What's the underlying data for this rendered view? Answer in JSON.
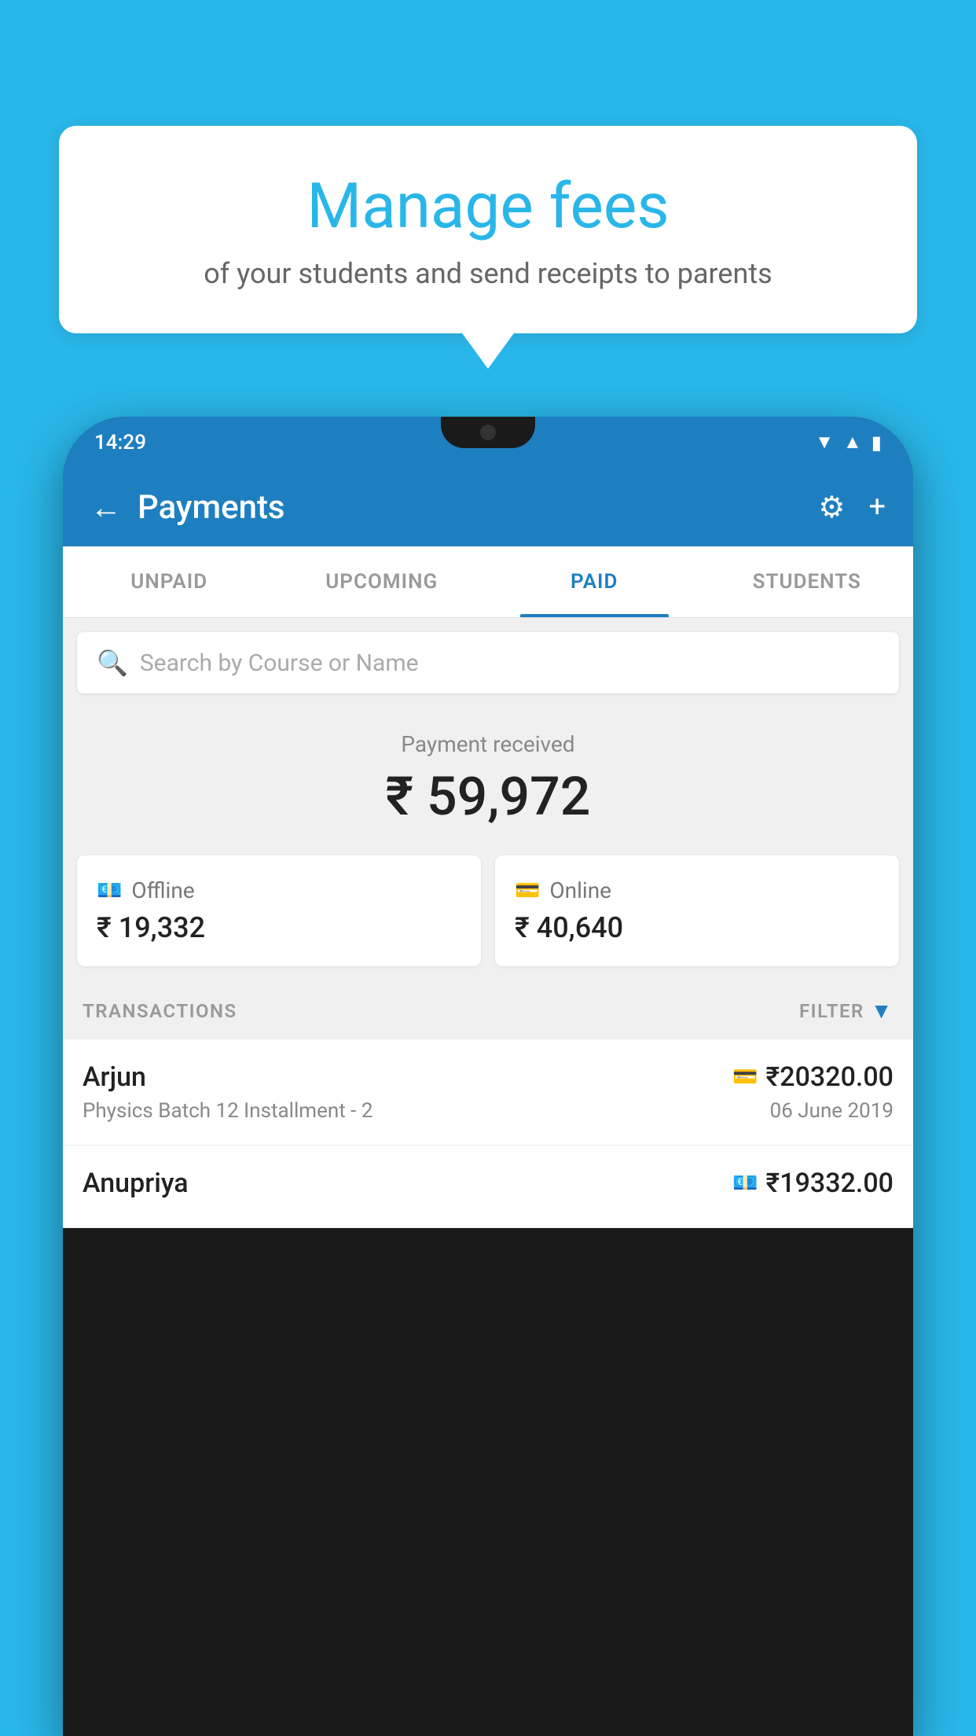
{
  "background_color": "#29b6e8",
  "speech_bubble": {
    "title": "Manage fees",
    "subtitle": "of your students and send receipts to parents"
  },
  "status_bar": {
    "time": "14:29",
    "wifi_icon": "▼",
    "signal_icon": "▲",
    "battery_icon": "▮"
  },
  "header": {
    "back_label": "←",
    "title": "Payments",
    "gear_icon": "⚙",
    "plus_icon": "+"
  },
  "tabs": [
    {
      "label": "UNPAID",
      "active": false
    },
    {
      "label": "UPCOMING",
      "active": false
    },
    {
      "label": "PAID",
      "active": true
    },
    {
      "label": "STUDENTS",
      "active": false
    }
  ],
  "search": {
    "placeholder": "Search by Course or Name"
  },
  "payment_summary": {
    "label": "Payment received",
    "amount": "₹ 59,972"
  },
  "payment_cards": [
    {
      "type": "Offline",
      "icon": "cash",
      "amount": "₹ 19,332"
    },
    {
      "type": "Online",
      "icon": "card",
      "amount": "₹ 40,640"
    }
  ],
  "transactions_label": "TRANSACTIONS",
  "filter_label": "FILTER",
  "transactions": [
    {
      "name": "Arjun",
      "course": "Physics Batch 12 Installment - 2",
      "amount": "₹20320.00",
      "date": "06 June 2019",
      "payment_type": "card"
    },
    {
      "name": "Anupriya",
      "course": "",
      "amount": "₹19332.00",
      "date": "",
      "payment_type": "cash"
    }
  ]
}
